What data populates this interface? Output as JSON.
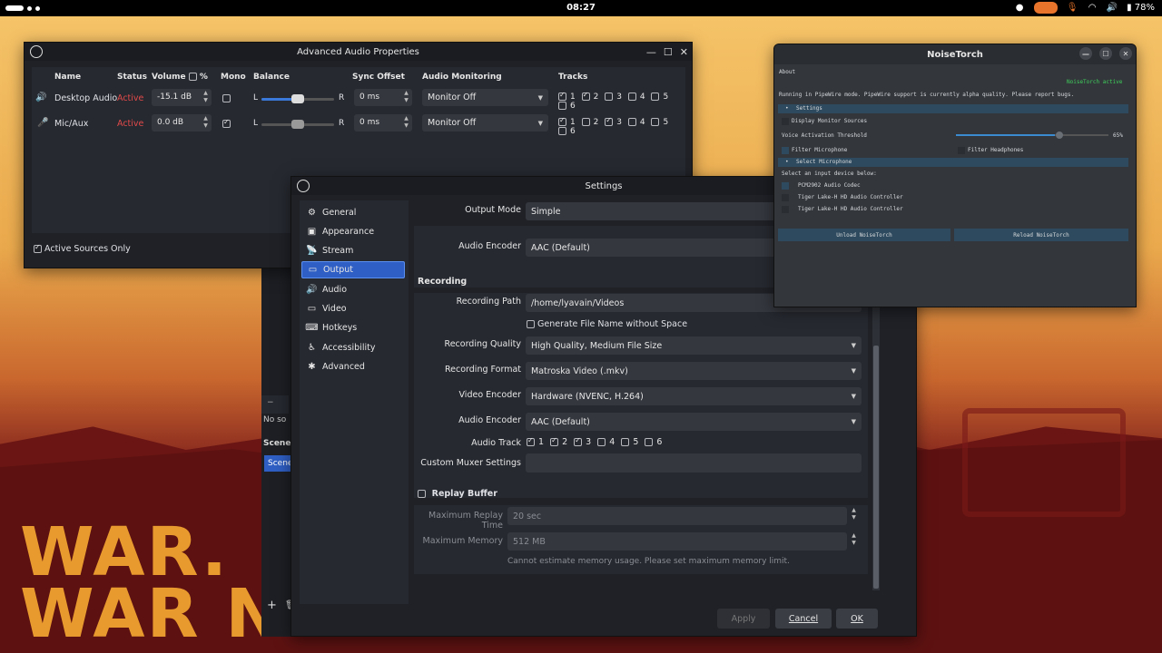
{
  "topbar": {
    "clock": "08:27",
    "battery": "78%"
  },
  "wallpaper": {
    "line1": "WAR.",
    "line2": "WAR NEV"
  },
  "adv_audio": {
    "title": "Advanced Audio Properties",
    "headers": {
      "name": "Name",
      "status": "Status",
      "volume": "Volume",
      "pct": "%",
      "mono": "Mono",
      "balance": "Balance",
      "sync": "Sync Offset",
      "monitoring": "Audio Monitoring",
      "tracks": "Tracks"
    },
    "rows": [
      {
        "name": "Desktop Audio",
        "status": "Active",
        "volume": "-15.1 dB",
        "mono": false,
        "bal_l": "L",
        "bal_r": "R",
        "balance": 0.5,
        "sync": "0 ms",
        "monitoring": "Monitor Off",
        "tracks": [
          "1",
          "2",
          "3",
          "4",
          "5",
          "6"
        ],
        "tracks_on": [
          true,
          true,
          false,
          false,
          false,
          false
        ]
      },
      {
        "name": "Mic/Aux",
        "status": "Active",
        "volume": "0.0 dB",
        "mono": true,
        "bal_l": "L",
        "bal_r": "R",
        "balance": 0.5,
        "sync": "0 ms",
        "monitoring": "Monitor Off",
        "tracks": [
          "1",
          "2",
          "3",
          "4",
          "5",
          "6"
        ],
        "tracks_on": [
          true,
          false,
          true,
          false,
          false,
          false
        ]
      }
    ],
    "active_only": "Active Sources Only"
  },
  "settings": {
    "title": "Settings",
    "nav": [
      "General",
      "Appearance",
      "Stream",
      "Output",
      "Audio",
      "Video",
      "Hotkeys",
      "Accessibility",
      "Advanced"
    ],
    "nav_icons": [
      "gear-icon",
      "appearance-icon",
      "stream-icon",
      "output-icon",
      "audio-icon",
      "video-icon",
      "hotkeys-icon",
      "accessibility-icon",
      "advanced-icon"
    ],
    "output_mode_label": "Output Mode",
    "output_mode": "Simple",
    "audio_encoder_label": "Audio Encoder",
    "audio_encoder_top": "AAC (Default)",
    "recording": {
      "title": "Recording",
      "path_label": "Recording Path",
      "path": "/home/lyavain/Videos",
      "gen_filename": "Generate File Name without Space",
      "quality_label": "Recording Quality",
      "quality": "High Quality, Medium File Size",
      "format_label": "Recording Format",
      "format": "Matroska Video (.mkv)",
      "video_enc_label": "Video Encoder",
      "video_enc": "Hardware (NVENC, H.264)",
      "audio_enc_label": "Audio Encoder",
      "audio_enc": "AAC (Default)",
      "track_label": "Audio Track",
      "tracks": [
        "1",
        "2",
        "3",
        "4",
        "5",
        "6"
      ],
      "tracks_on": [
        true,
        true,
        true,
        false,
        false,
        false
      ],
      "muxer_label": "Custom Muxer Settings"
    },
    "replay": {
      "title": "Replay Buffer",
      "max_time_label": "Maximum Replay Time",
      "max_time": "20 sec",
      "max_mem_label": "Maximum Memory",
      "max_mem": "512 MB",
      "note": "Cannot estimate memory usage. Please set maximum memory limit."
    },
    "buttons": {
      "apply": "Apply",
      "cancel": "Cancel",
      "ok": "OK"
    }
  },
  "obs_bg": {
    "no_sources": "No so",
    "scenes": "Scene",
    "scene_item": "Scene",
    "s": "S"
  },
  "noisetorch": {
    "title": "NoiseTorch",
    "about": "About",
    "status": "NoiseTorch active",
    "info": "Running in PipeWire mode. PipeWire support is currently alpha quality. Please report bugs.",
    "settings": "Settings",
    "display_monitor": "Display Monitor Sources",
    "threshold_label": "Voice Activation Threshold",
    "threshold_value": "65%",
    "threshold": 0.65,
    "filter_mic": "Filter Microphone",
    "filter_head": "Filter Headphones",
    "select_mic": "Select Microphone",
    "select_prompt": "Select an input device below:",
    "devices": [
      "PCM2902 Audio Codec",
      "Tiger Lake-H HD Audio Controller",
      "Tiger Lake-H HD Audio Controller"
    ],
    "unload": "Unload NoiseTorch",
    "reload": "Reload NoiseTorch"
  }
}
